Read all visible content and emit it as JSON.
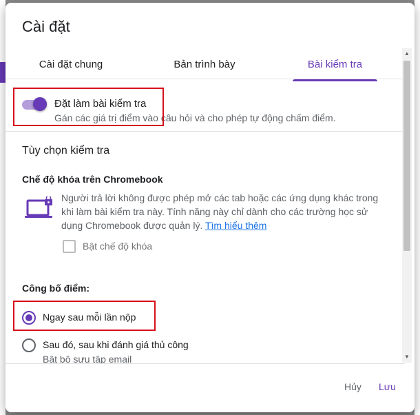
{
  "dialog": {
    "title": "Cài đặt",
    "tabs": [
      {
        "label": "Cài đặt chung",
        "active": false
      },
      {
        "label": "Bản trình bày",
        "active": false
      },
      {
        "label": "Bài kiểm tra",
        "active": true
      }
    ]
  },
  "quiz_toggle": {
    "title": "Đặt làm bài kiểm tra",
    "description": "Gán các giá trị điểm vào câu hỏi và cho phép tự động chấm điểm.",
    "enabled": true
  },
  "quiz_options": {
    "title": "Tùy chọn kiểm tra",
    "lock_mode": {
      "heading": "Chế độ khóa trên Chromebook",
      "description": "Người trả lời không được phép mở các tab hoặc các ứng dụng khác trong khi làm bài kiểm tra này. Tính năng này chỉ dành cho các trường học sử dụng Chromebook được quản lý.",
      "learn_more": "Tìm hiểu thêm",
      "checkbox_label": "Bật chế độ khóa",
      "checked": false,
      "icon": "laptop-lock-icon"
    }
  },
  "release_scores": {
    "heading": "Công bố điểm:",
    "options": [
      {
        "label": "Ngay sau mỗi lần nộp",
        "checked": true
      },
      {
        "label": "Sau đó, sau khi đánh giá thủ công",
        "sub": "Bật bộ sưu tập email",
        "checked": false
      }
    ]
  },
  "footer": {
    "cancel_label": "Hủy",
    "save_label": "Lưu"
  },
  "colors": {
    "accent": "#673ab7",
    "accent_light": "#b39ddb",
    "link": "#1a73e8",
    "highlight_box": "#d5101b"
  }
}
